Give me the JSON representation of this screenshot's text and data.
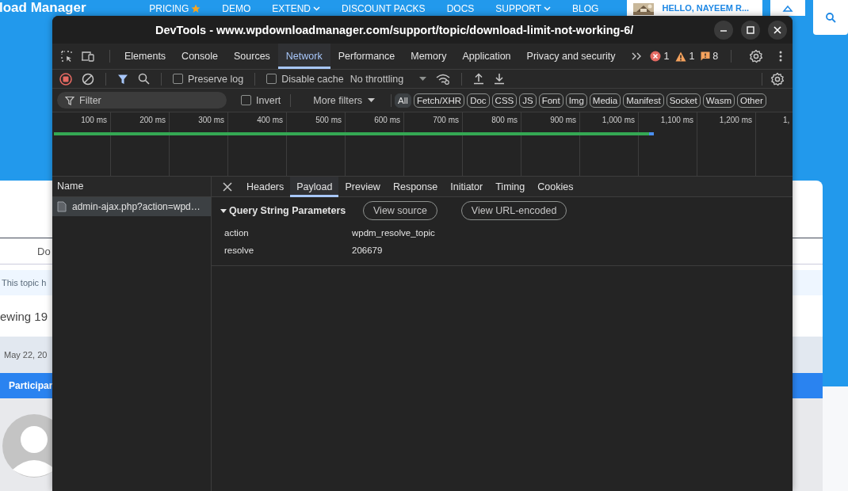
{
  "website": {
    "logo": "load Manager",
    "nav": [
      {
        "label": "PRICING",
        "kind": "featured"
      },
      {
        "label": "DEMO",
        "kind": "plain"
      },
      {
        "label": "EXTEND",
        "kind": "dropdown"
      },
      {
        "label": "DISCOUNT PACKS",
        "kind": "plain"
      },
      {
        "label": "DOCS",
        "kind": "plain"
      },
      {
        "label": "SUPPORT",
        "kind": "dropdown"
      },
      {
        "label": "BLOG",
        "kind": "plain"
      }
    ],
    "user_button": "HELLO, NAYEEM R...",
    "topic": {
      "tab": "Do",
      "notice": "This topic h",
      "viewing": "ewing 19",
      "date": "May 22, 20",
      "participants": "Participar"
    }
  },
  "devtools": {
    "title": "DevTools - www.wpdownloadmanager.com/support/topic/download-limit-not-working-6/",
    "panels": [
      {
        "label": "Elements",
        "selected": false
      },
      {
        "label": "Console",
        "selected": false
      },
      {
        "label": "Sources",
        "selected": false
      },
      {
        "label": "Network",
        "selected": true
      },
      {
        "label": "Performance",
        "selected": false
      },
      {
        "label": "Memory",
        "selected": false
      },
      {
        "label": "Application",
        "selected": false
      },
      {
        "label": "Privacy and security",
        "selected": false
      }
    ],
    "counts": {
      "errors": "1",
      "warnings": "1",
      "issues": "8"
    },
    "toolbar": {
      "recording": true,
      "preserve_log": {
        "label": "Preserve log",
        "checked": false
      },
      "disable_cache": {
        "label": "Disable cache",
        "checked": false
      },
      "throttling": "No throttling"
    },
    "filter": {
      "placeholder": "Filter",
      "invert": {
        "label": "Invert",
        "checked": false
      },
      "more_filters": "More filters",
      "types": [
        {
          "label": "All",
          "selected": true
        },
        {
          "label": "Fetch/XHR",
          "selected": false
        },
        {
          "label": "Doc",
          "selected": false
        },
        {
          "label": "CSS",
          "selected": false
        },
        {
          "label": "JS",
          "selected": false
        },
        {
          "label": "Font",
          "selected": false
        },
        {
          "label": "Img",
          "selected": false
        },
        {
          "label": "Media",
          "selected": false
        },
        {
          "label": "Manifest",
          "selected": false
        },
        {
          "label": "Socket",
          "selected": false
        },
        {
          "label": "Wasm",
          "selected": false
        },
        {
          "label": "Other",
          "selected": false
        }
      ]
    },
    "timeline": {
      "ticks": [
        "100 ms",
        "200 ms",
        "300 ms",
        "400 ms",
        "500 ms",
        "600 ms",
        "700 ms",
        "800 ms",
        "900 ms",
        "1,000 ms",
        "1,100 ms",
        "1,200 ms",
        "1,"
      ],
      "bar": {
        "level": 0.81
      }
    },
    "requests": {
      "column": "Name",
      "rows": [
        {
          "name": "admin-ajax.php?action=wpd…",
          "selected": true
        }
      ]
    },
    "details": {
      "tabs": [
        {
          "label": "Headers",
          "selected": false
        },
        {
          "label": "Payload",
          "selected": true
        },
        {
          "label": "Preview",
          "selected": false
        },
        {
          "label": "Response",
          "selected": false
        },
        {
          "label": "Initiator",
          "selected": false
        },
        {
          "label": "Timing",
          "selected": false
        },
        {
          "label": "Cookies",
          "selected": false
        }
      ],
      "section": {
        "title": "Query String Parameters",
        "expanded": true,
        "buttons": [
          "View source",
          "View URL-encoded"
        ],
        "params": [
          {
            "key": "action",
            "value": "wpdm_resolve_topic"
          },
          {
            "key": "resolve",
            "value": "206679"
          }
        ]
      }
    }
  }
}
